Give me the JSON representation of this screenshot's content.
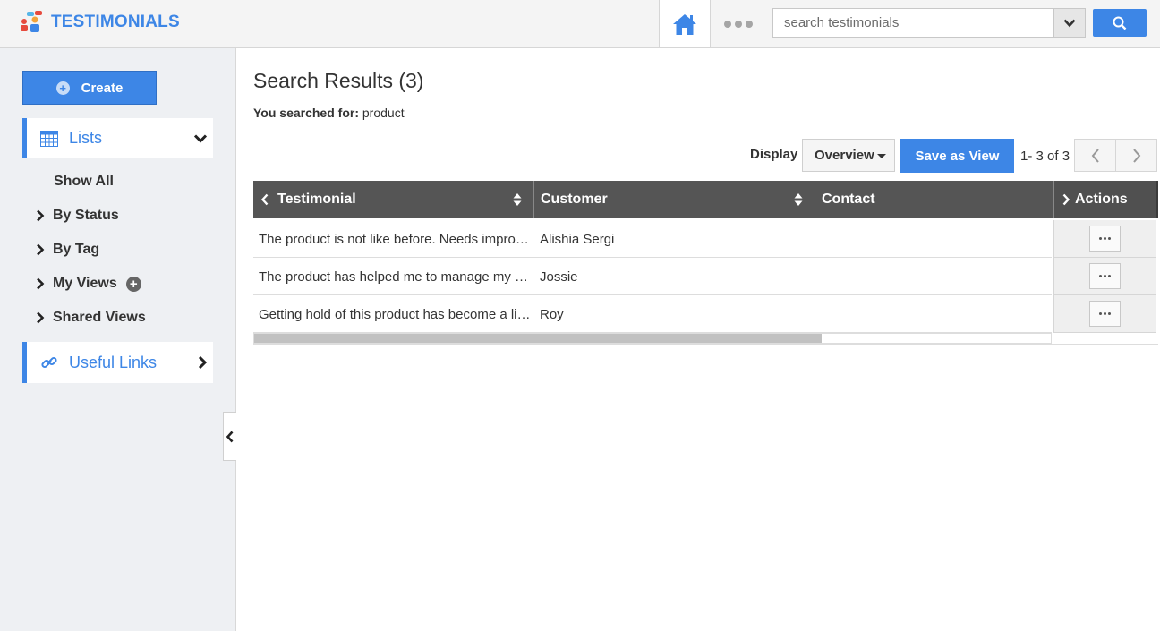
{
  "app": {
    "title": "TESTIMONIALS"
  },
  "search": {
    "placeholder": "search testimonials"
  },
  "sidebar": {
    "create_label": "Create",
    "lists_label": "Lists",
    "items": [
      {
        "label": "Show All"
      },
      {
        "label": "By Status"
      },
      {
        "label": "By Tag"
      },
      {
        "label": "My Views"
      },
      {
        "label": "Shared Views"
      }
    ],
    "useful_links_label": "Useful Links"
  },
  "main": {
    "title": "Search Results (3)",
    "searched_for_label": "You searched for:",
    "searched_for_value": "product",
    "display_label": "Display",
    "display_value": "Overview",
    "save_view_label": "Save as View",
    "pager_text": "1- 3 of 3"
  },
  "table": {
    "columns": [
      "Testimonial",
      "Customer",
      "Contact",
      "Actions"
    ],
    "rows": [
      {
        "testimonial": "The product is not like before. Needs improvement",
        "customer": "Alishia Sergi",
        "contact": ""
      },
      {
        "testimonial": "The product has helped me to manage my work",
        "customer": "Jossie",
        "contact": ""
      },
      {
        "testimonial": "Getting hold of this product has become a little difficult",
        "customer": "Roy",
        "contact": ""
      }
    ]
  },
  "colors": {
    "accent": "#3d86e6",
    "header_bg": "#555555",
    "sidebar_bg": "#eef0f3"
  }
}
